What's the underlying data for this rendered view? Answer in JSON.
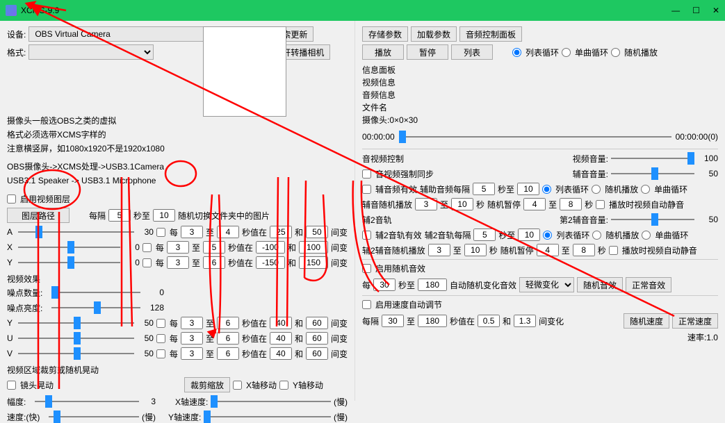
{
  "title": "XCMS-9.9",
  "win": {
    "min": "—",
    "max": "☐",
    "close": "✕"
  },
  "device_label": "设备:",
  "device_value": "OBS Virtual Camera",
  "format_label": "格式:",
  "btn_search_update": "检索更新",
  "btn_open_relay": "打开转播相机",
  "tips1": "摄像头一般选OBS之类的虚拟",
  "tips2": "格式必须选带XCMS字样的",
  "tips3": "注意横竖屏，如1080x1920不是1920x1080",
  "tips4": "OBS摄像头->XCMS处理->USB3.1Camera",
  "tips5": "USB3.1 Speaker -> USB3.1 Microphone",
  "enable_layer": "启用视频图层",
  "btn_layer_path": "图层路径",
  "interval": "每隔",
  "sec_to": "秒至",
  "random_switch": "随机切换文件夹中的图片",
  "layer_i1": "5",
  "layer_i2": "10",
  "axy": {
    "A": {
      "v": "30",
      "e": "3",
      "s": "4",
      "lo": "25",
      "hi": "50"
    },
    "X": {
      "v": "0",
      "e": "3",
      "s": "5",
      "lo": "-100",
      "hi": "100"
    },
    "Y": {
      "v": "0",
      "e": "3",
      "s": "6",
      "lo": "-150",
      "hi": "150"
    }
  },
  "every": "每",
  "to": "至",
  "sec_val_in": "秒值在",
  "and": "和",
  "between": "间变",
  "vfx": "视频效果",
  "noise_count": "噪点数量:",
  "noise_count_v": "0",
  "noise_bright": "噪点亮度:",
  "noise_bright_v": "128",
  "yuv": {
    "Y": {
      "v": "50",
      "e": "3",
      "s": "6",
      "lo": "40",
      "hi": "60"
    },
    "U": {
      "v": "50",
      "e": "3",
      "s": "6",
      "lo": "40",
      "hi": "60"
    },
    "V": {
      "v": "50",
      "e": "3",
      "s": "6",
      "lo": "40",
      "hi": "60"
    }
  },
  "crop_title": "视频区域裁剪或随机晃动",
  "lens_shake": "镜头晃动",
  "amplitude": "幅度:",
  "amplitude_v": "3",
  "speed_fast": "速度:(快)",
  "slow": "(慢)",
  "btn_crop_zoom": "裁剪缩放",
  "x_shift": "X轴移动",
  "y_shift": "Y轴移动",
  "x_speed": "X轴速度:",
  "y_speed": "Y轴速度:",
  "btn_save": "存储参数",
  "btn_load": "加载参数",
  "btn_audio_panel": "音频控制面板",
  "btn_play": "播放",
  "btn_pause": "暂停",
  "btn_list": "列表",
  "loop_list": "列表循环",
  "loop_single": "单曲循环",
  "random_play": "随机播放",
  "info_title": "信息面板",
  "info_video": "视频信息",
  "info_audio": "音频信息",
  "info_file": "文件名",
  "info_cam": "摄像头:0×0×30",
  "time_cur": "00:00:00",
  "time_total": "00:00:00(0)",
  "av_ctrl": "音视频控制",
  "video_vol": "视频音量:",
  "video_vol_v": "100",
  "av_sync": "音视频强制同步",
  "aux_vol": "辅音音量:",
  "aux_vol_v": "50",
  "aux_valid": "辅音频有效",
  "aux_interval": "辅助音频每隔",
  "aux_i1": "5",
  "aux_i2": "10",
  "aux_rand_play": "辅音随机播放",
  "aux_r1": "3",
  "aux_r2": "10",
  "sec": "秒",
  "rand_pause": "随机暂停",
  "aux_p1": "4",
  "aux_p2": "8",
  "mute_on_play": "播放时视频自动静音",
  "aux2_track": "辅2音轨",
  "aux2_vol": "第2辅音音量:",
  "aux2_vol_v": "50",
  "aux2_valid": "辅2音轨有效",
  "aux2_interval": "辅2音轨每隔",
  "aux2_i1": "5",
  "aux2_i2": "10",
  "aux2_rand": "辅2辅音随机播放",
  "aux2_r1": "3",
  "aux2_r2": "10",
  "aux2_p1": "4",
  "aux2_p2": "8",
  "enable_rand_sfx": "启用随机音效",
  "sfx_i1": "30",
  "sfx_i2": "180",
  "auto_sfx": "自动随机变化音效",
  "sfx_preset": "轻微变化",
  "btn_rand_sfx": "随机音效",
  "btn_normal_sfx": "正常音效",
  "enable_speed": "启用速度自动调节",
  "spd_i1": "30",
  "spd_i2": "180",
  "spd_lo": "0.5",
  "spd_hi": "1.3",
  "between2": "间变化",
  "btn_rand_speed": "随机速度",
  "btn_normal_speed": "正常速度",
  "rate": "速率:1.0"
}
